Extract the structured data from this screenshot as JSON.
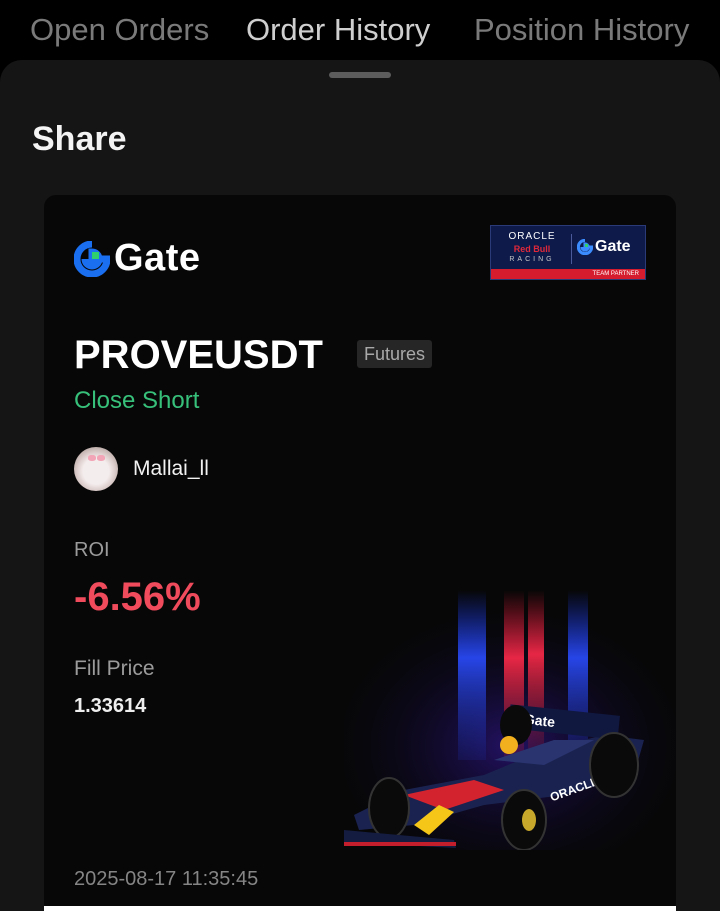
{
  "tabs": [
    {
      "label": "Open Orders"
    },
    {
      "label": "Order History"
    },
    {
      "label": "Position History"
    }
  ],
  "sheet": {
    "title": "Share"
  },
  "card": {
    "brand": "Gate",
    "partner": {
      "oracle": "ORACLE",
      "redbull": "Red Bull",
      "racing": "RACING",
      "gate": "Gate",
      "team_partner": "TEAM PARTNER"
    },
    "pair": "PROVEUSDT",
    "market_type": "Futures",
    "side": "Close Short",
    "user": {
      "name": "Mallai_ll"
    },
    "roi_label": "ROI",
    "roi_value": "-6.56%",
    "fill_price_label": "Fill Price",
    "fill_price_value": "1.33614",
    "timestamp": "2025-08-17 11:35:45",
    "car_sponsor": "Gate",
    "car_oracle": "ORACLE"
  },
  "colors": {
    "positive": "#37c07a",
    "negative": "#ef4b5c",
    "brand_blue": "#1a6ff0",
    "brand_green": "#2fcf6e"
  },
  "icons": [
    "gate-logo-icon",
    "avatar"
  ]
}
